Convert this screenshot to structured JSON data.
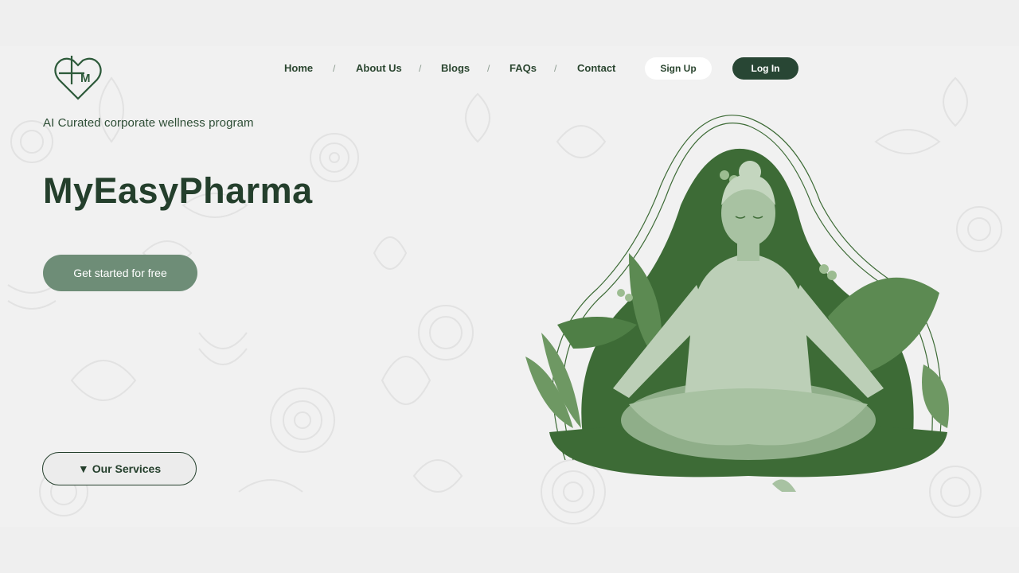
{
  "nav": {
    "links": [
      "Home",
      "About Us",
      "Blogs",
      "FAQs",
      "Contact"
    ],
    "separator": "/",
    "signup_label": "Sign Up",
    "login_label": "Log In"
  },
  "logo": {
    "letter": "M"
  },
  "hero": {
    "tagline": "AI Curated corporate wellness program",
    "brand": "MyEasyPharma",
    "cta_label": "Get started for free",
    "services_arrow": "▼",
    "services_label": "Our Services"
  },
  "colors": {
    "dark_green": "#284634",
    "muted_green": "#6e8d77",
    "illustration_green": "#3d6b36",
    "background": "#f1f1f1"
  },
  "icons": [
    "heart-cross-logo-icon",
    "meditation-illustration",
    "down-triangle-icon"
  ]
}
